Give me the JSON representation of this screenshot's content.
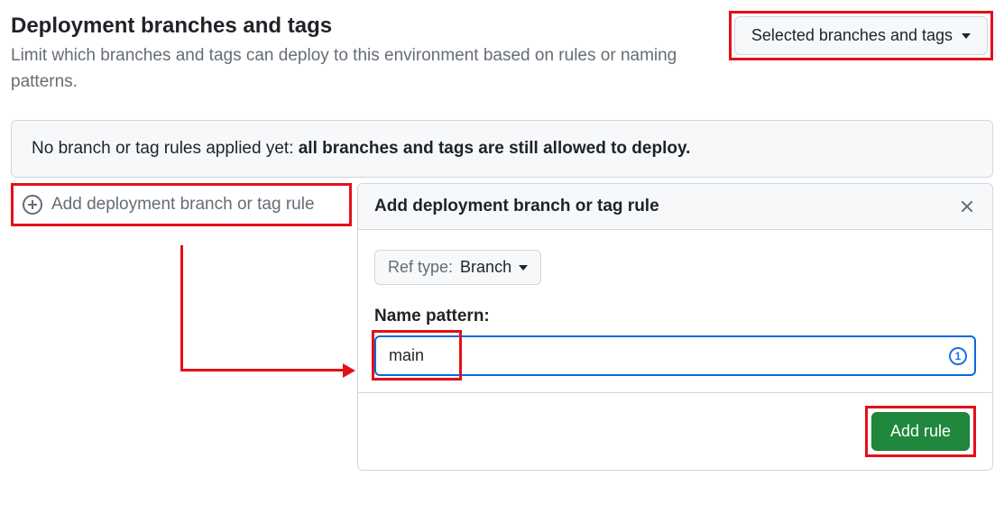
{
  "section": {
    "title": "Deployment branches and tags",
    "description": "Limit which branches and tags can deploy to this environment based on rules or naming patterns."
  },
  "dropdown": {
    "label": "Selected branches and tags"
  },
  "rules_panel": {
    "prefix": "No branch or tag rules applied yet: ",
    "emphasis": "all branches and tags are still allowed to deploy."
  },
  "add_rule_link": {
    "label": "Add deployment branch or tag rule"
  },
  "dialog": {
    "title": "Add deployment branch or tag rule",
    "ref_type": {
      "label": "Ref type:",
      "value": "Branch"
    },
    "name_pattern": {
      "label": "Name pattern:",
      "value": "main"
    },
    "submit_label": "Add rule"
  },
  "annotations": {
    "highlight_color": "#e41019"
  }
}
